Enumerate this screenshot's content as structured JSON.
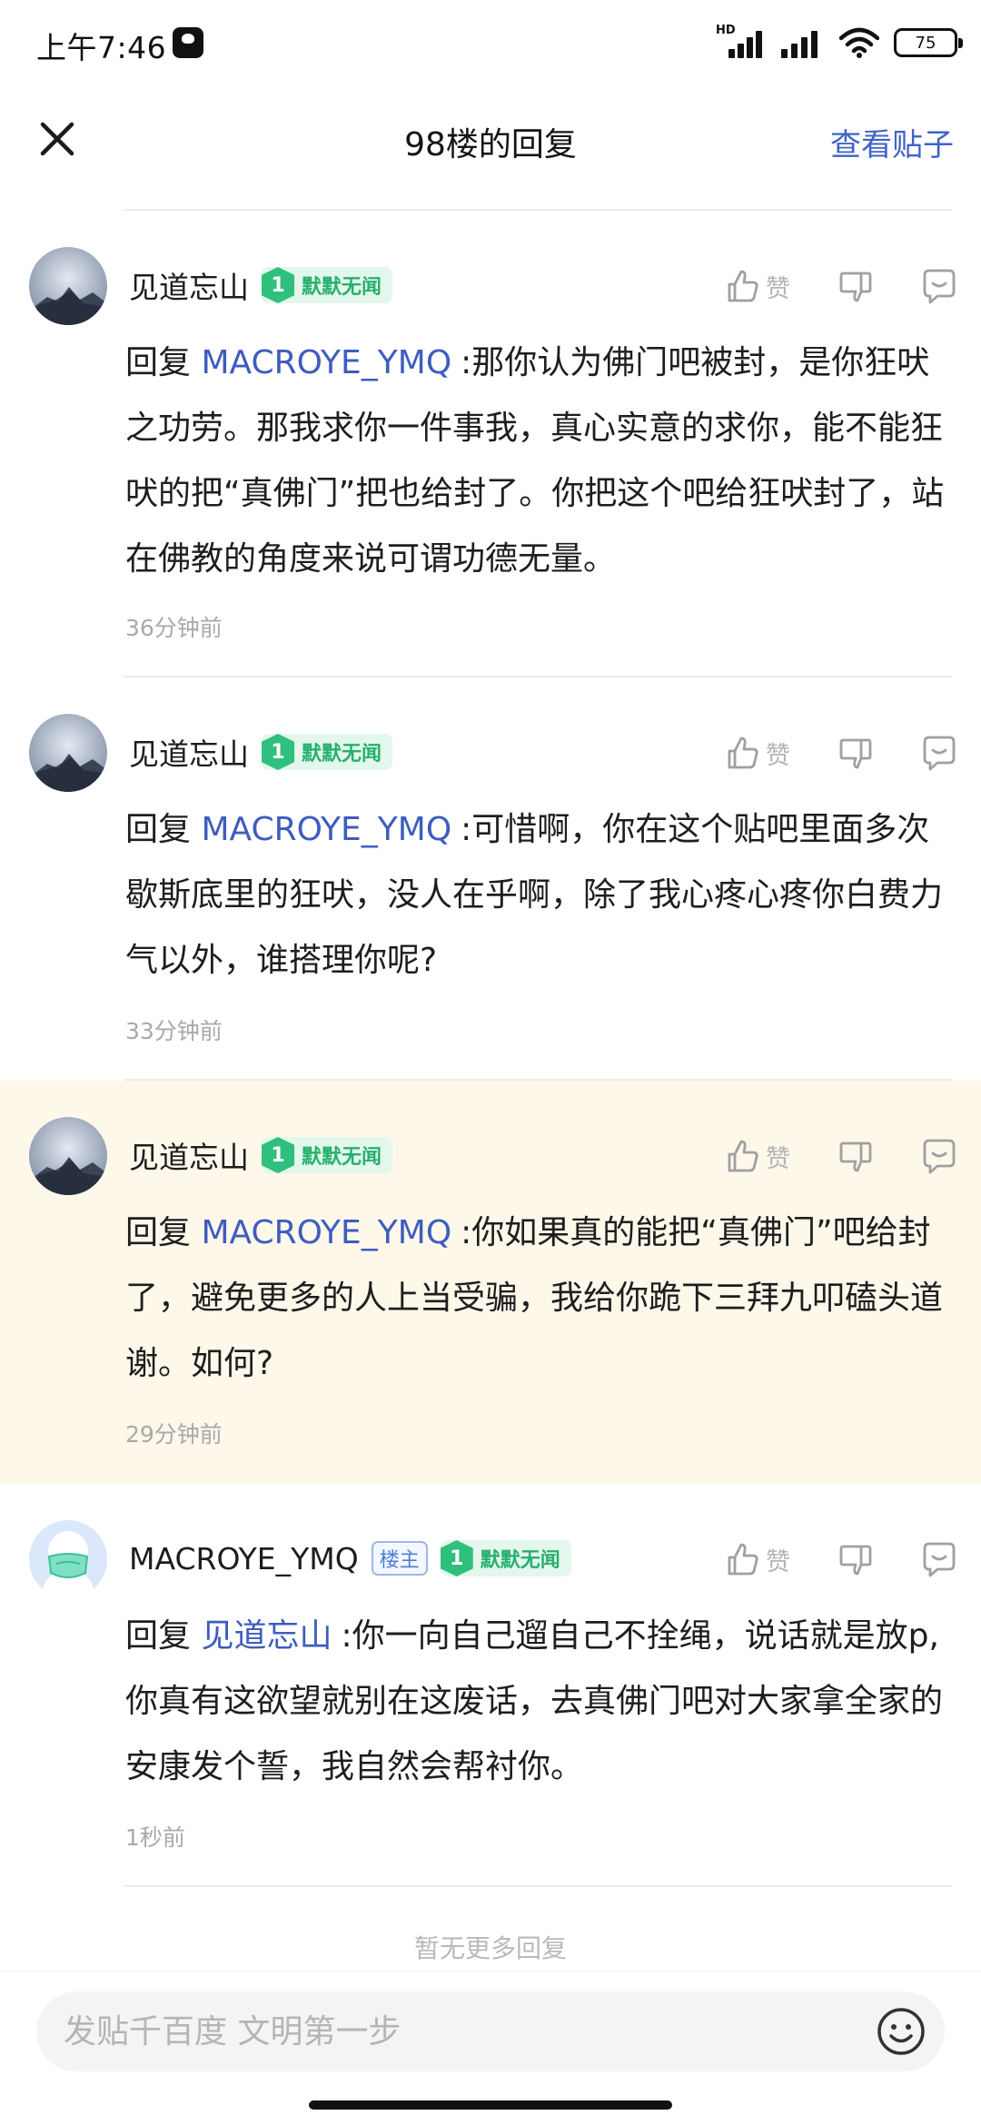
{
  "status_bar": {
    "time": "上午7:46",
    "network_label": "HD",
    "battery": "75"
  },
  "header": {
    "title": "98楼的回复",
    "view_post": "查看贴子"
  },
  "replies": [
    {
      "username": "见道忘山",
      "level": "1",
      "level_title": "默默无闻",
      "like_label": "赞",
      "reply_prefix": "回复",
      "mention": "MACROYE_YMQ",
      "text": ":那你认为佛门吧被封，是你狂吠之功劳。那我求你一件事我，真心实意的求你，能不能狂吠的把“真佛门”把也给封了。你把这个吧给狂吠封了，站在佛教的角度来说可谓功德无量。",
      "time": "36分钟前"
    },
    {
      "username": "见道忘山",
      "level": "1",
      "level_title": "默默无闻",
      "like_label": "赞",
      "reply_prefix": "回复",
      "mention": "MACROYE_YMQ",
      "text": ":可惜啊，你在这个贴吧里面多次歇斯底里的狂吠，没人在乎啊，除了我心疼心疼你白费力气以外，谁搭理你呢?",
      "time": "33分钟前"
    },
    {
      "username": "见道忘山",
      "level": "1",
      "level_title": "默默无闻",
      "like_label": "赞",
      "reply_prefix": "回复",
      "mention": "MACROYE_YMQ",
      "text": ":你如果真的能把“真佛门”吧给封了，避免更多的人上当受骗，我给你跪下三拜九叩磕头道谢。如何?",
      "time": "29分钟前"
    },
    {
      "username": "MACROYE_YMQ",
      "owner_badge": "楼主",
      "level": "1",
      "level_title": "默默无闻",
      "like_label": "赞",
      "reply_prefix": "回复",
      "mention": "见道忘山",
      "text": ":你一向自己遛自己不拴绳，说话就是放p,你真有这欲望就别在这废话，去真佛门吧对大家拿全家的安康发个誓，我自然会帮衬你。",
      "time": "1秒前"
    }
  ],
  "footer": {
    "no_more": "暂无更多回复",
    "input_placeholder": "发贴千百度 文明第一步"
  },
  "colors": {
    "accent": "#3f63c7",
    "highlight_bg": "#fdf8ea",
    "level_green": "#2fc07d"
  }
}
